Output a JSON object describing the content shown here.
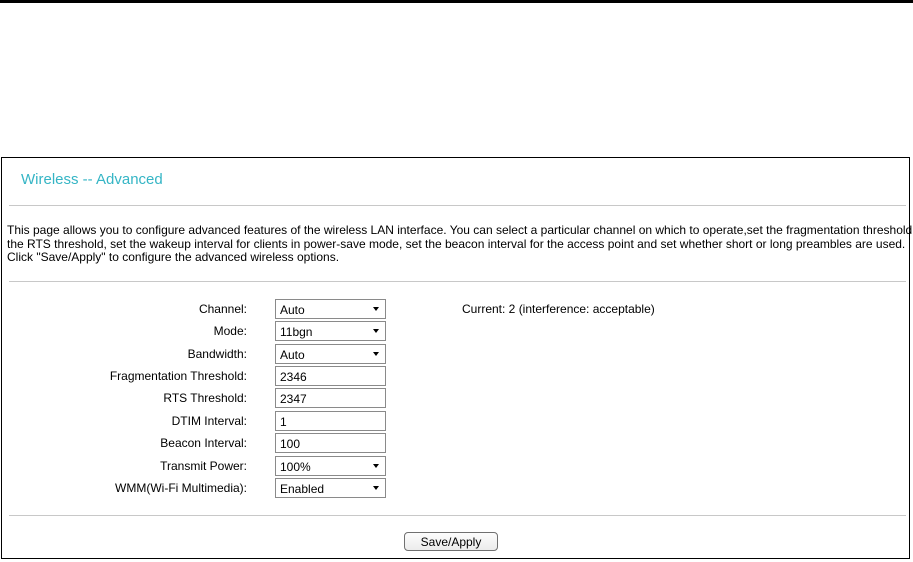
{
  "page": {
    "title": "Wireless -- Advanced",
    "description_lines": [
      "This page allows you to configure advanced features of the wireless LAN interface. You can select a particular channel on which to operate,set the fragmentation threshold, set",
      "the RTS threshold, set the wakeup interval for clients in power-save mode, set the beacon interval for the access point and set whether short or long preambles are used.",
      "Click \"Save/Apply\" to configure the advanced wireless options."
    ]
  },
  "form": {
    "channel": {
      "label": "Channel:",
      "value": "Auto",
      "status": "Current: 2 (interference: acceptable)"
    },
    "mode": {
      "label": "Mode:",
      "value": "11bgn"
    },
    "bandwidth": {
      "label": "Bandwidth:",
      "value": "Auto"
    },
    "fragmentation_threshold": {
      "label": "Fragmentation Threshold:",
      "value": "2346"
    },
    "rts_threshold": {
      "label": "RTS Threshold:",
      "value": "2347"
    },
    "dtim_interval": {
      "label": "DTIM Interval:",
      "value": "1"
    },
    "beacon_interval": {
      "label": "Beacon Interval:",
      "value": "100"
    },
    "transmit_power": {
      "label": "Transmit Power:",
      "value": "100%"
    },
    "wmm": {
      "label": "WMM(Wi-Fi Multimedia):",
      "value": "Enabled"
    }
  },
  "actions": {
    "save_apply": "Save/Apply"
  },
  "colors": {
    "title": "#35b5c5",
    "divider": "#c8c8c8"
  }
}
